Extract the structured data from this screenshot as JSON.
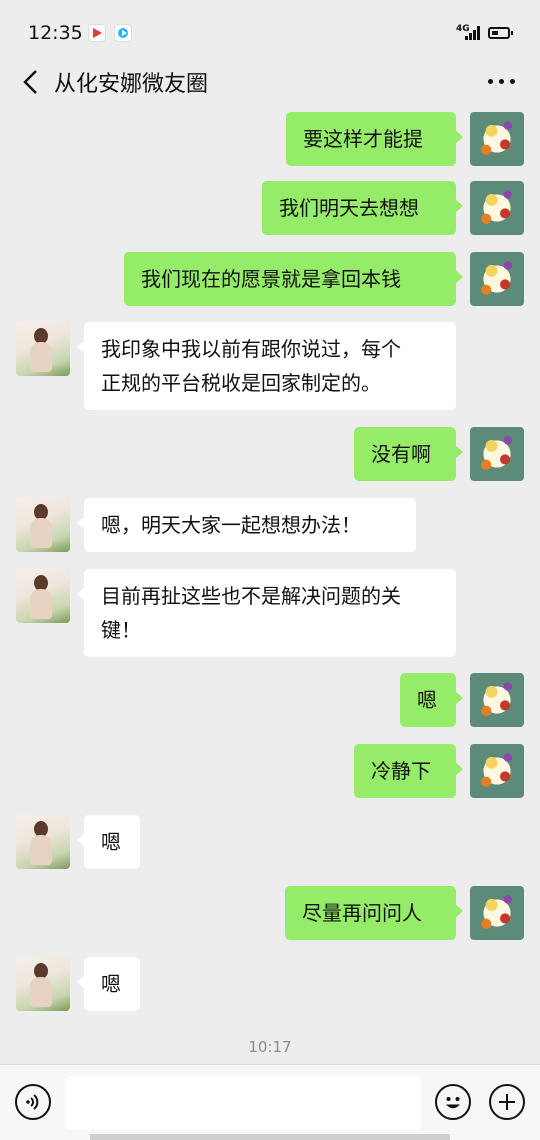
{
  "status_bar": {
    "time": "12:35",
    "network": "4G"
  },
  "header": {
    "title": "从化安娜微友圈",
    "back_icon": "chevron-left-icon",
    "more_icon": "more-dots-icon"
  },
  "messages": [
    {
      "side": "right",
      "text": "要这样才能提"
    },
    {
      "side": "right",
      "text": "我们明天去想想"
    },
    {
      "side": "right",
      "text": "我们现在的愿景就是拿回本钱"
    },
    {
      "side": "left",
      "text": "我印象中我以前有跟你说过，每个\n正规的平台税收是回家制定的。"
    },
    {
      "side": "right",
      "text": "没有啊"
    },
    {
      "side": "left",
      "text": "嗯，明天大家一起想想办法！"
    },
    {
      "side": "left",
      "text": "目前再扯这些也不是解决问题的关\n键！"
    },
    {
      "side": "right",
      "text": "嗯"
    },
    {
      "side": "right",
      "text": "冷静下"
    },
    {
      "side": "left",
      "text": "嗯"
    },
    {
      "side": "right",
      "text": "尽量再问问人"
    },
    {
      "side": "left",
      "text": "嗯"
    }
  ],
  "timestamp": "10:17",
  "input_bar": {
    "placeholder": "",
    "voice_icon": "voice-icon",
    "emoji_icon": "emoji-icon",
    "plus_icon": "plus-icon"
  },
  "colors": {
    "background": "#ededed",
    "self_bubble": "#95ec69",
    "other_bubble": "#ffffff"
  }
}
